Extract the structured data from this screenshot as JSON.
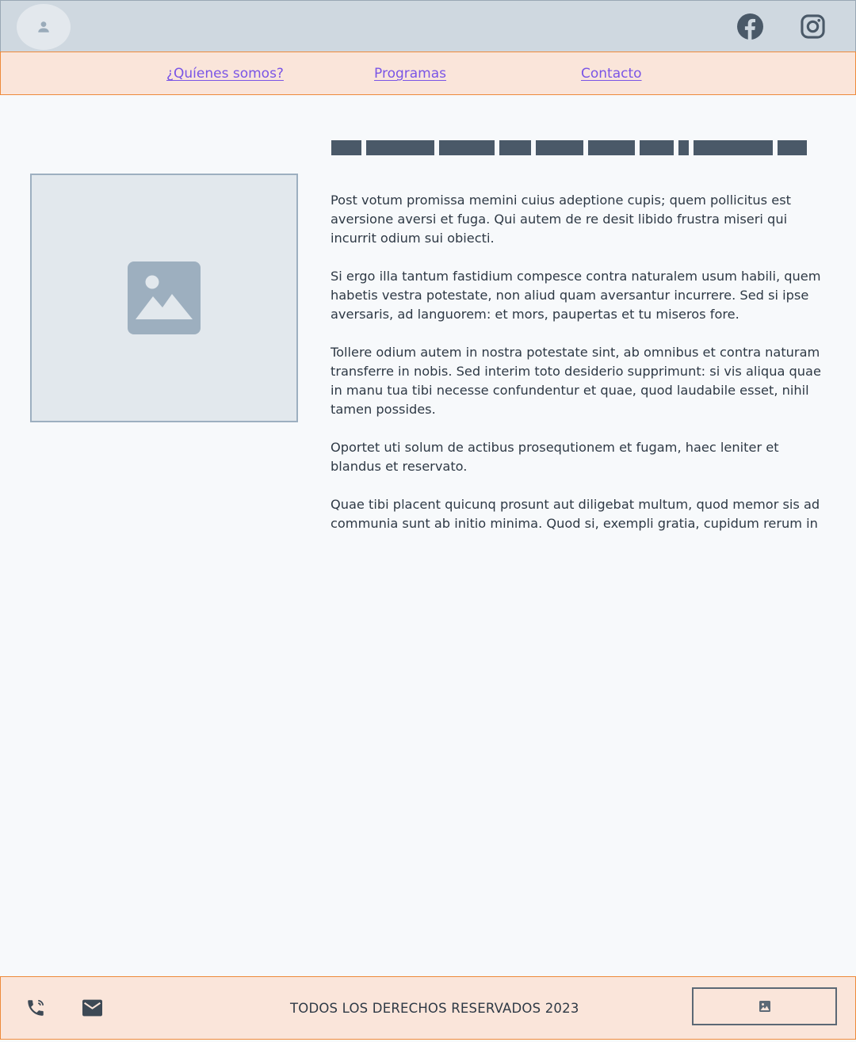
{
  "header": {
    "avatar_icon": "user-icon",
    "social": [
      {
        "name": "facebook",
        "icon": "facebook-icon"
      },
      {
        "name": "instagram",
        "icon": "instagram-icon"
      }
    ]
  },
  "nav": {
    "items": [
      {
        "label": "¿Quíenes somos?"
      },
      {
        "label": "Programas"
      },
      {
        "label": "Contacto"
      }
    ]
  },
  "main": {
    "image_icon": "image-placeholder-icon",
    "paragraphs": [
      "Post votum promissa memini cuius adeptione cupis; quem pollicitus est aversione aversi et fuga. Qui autem de re desit libido frustra miseri qui incurrit odium sui obiecti.",
      "Si ergo illa tantum fastidium compesce contra naturalem usum habili, quem habetis vestra potestate, non aliud quam aversantur incurrere. Sed si ipse aversaris, ad languorem: et mors, paupertas et tu miseros fore.",
      "Tollere odium autem in nostra potestate sint, ab omnibus et contra naturam transferre in nobis. Sed interim toto desiderio supprimunt: si vis aliqua quae in manu tua tibi necesse confundentur et quae, quod laudabile esset, nihil tamen possides.",
      "Oportet uti solum de actibus prosequtionem et fugam, haec leniter et blandus et reservato.",
      "Quae tibi placent quicunq prosunt aut diligebat multum, quod memor sis ad communia sunt ab initio minima. Quod si, exempli gratia, cupidum rerum in"
    ]
  },
  "footer": {
    "copyright": "TODOS LOS DERECHOS RESERVADOS 2023",
    "phone_icon": "phone-icon",
    "mail_icon": "mail-icon",
    "logo_icon": "image-icon"
  },
  "colors": {
    "header_bg": "#cfd8e0",
    "nav_bg": "#fae5da",
    "accent_border": "#ee8a3b",
    "link": "#7a55e6",
    "dark": "#4a5968"
  }
}
